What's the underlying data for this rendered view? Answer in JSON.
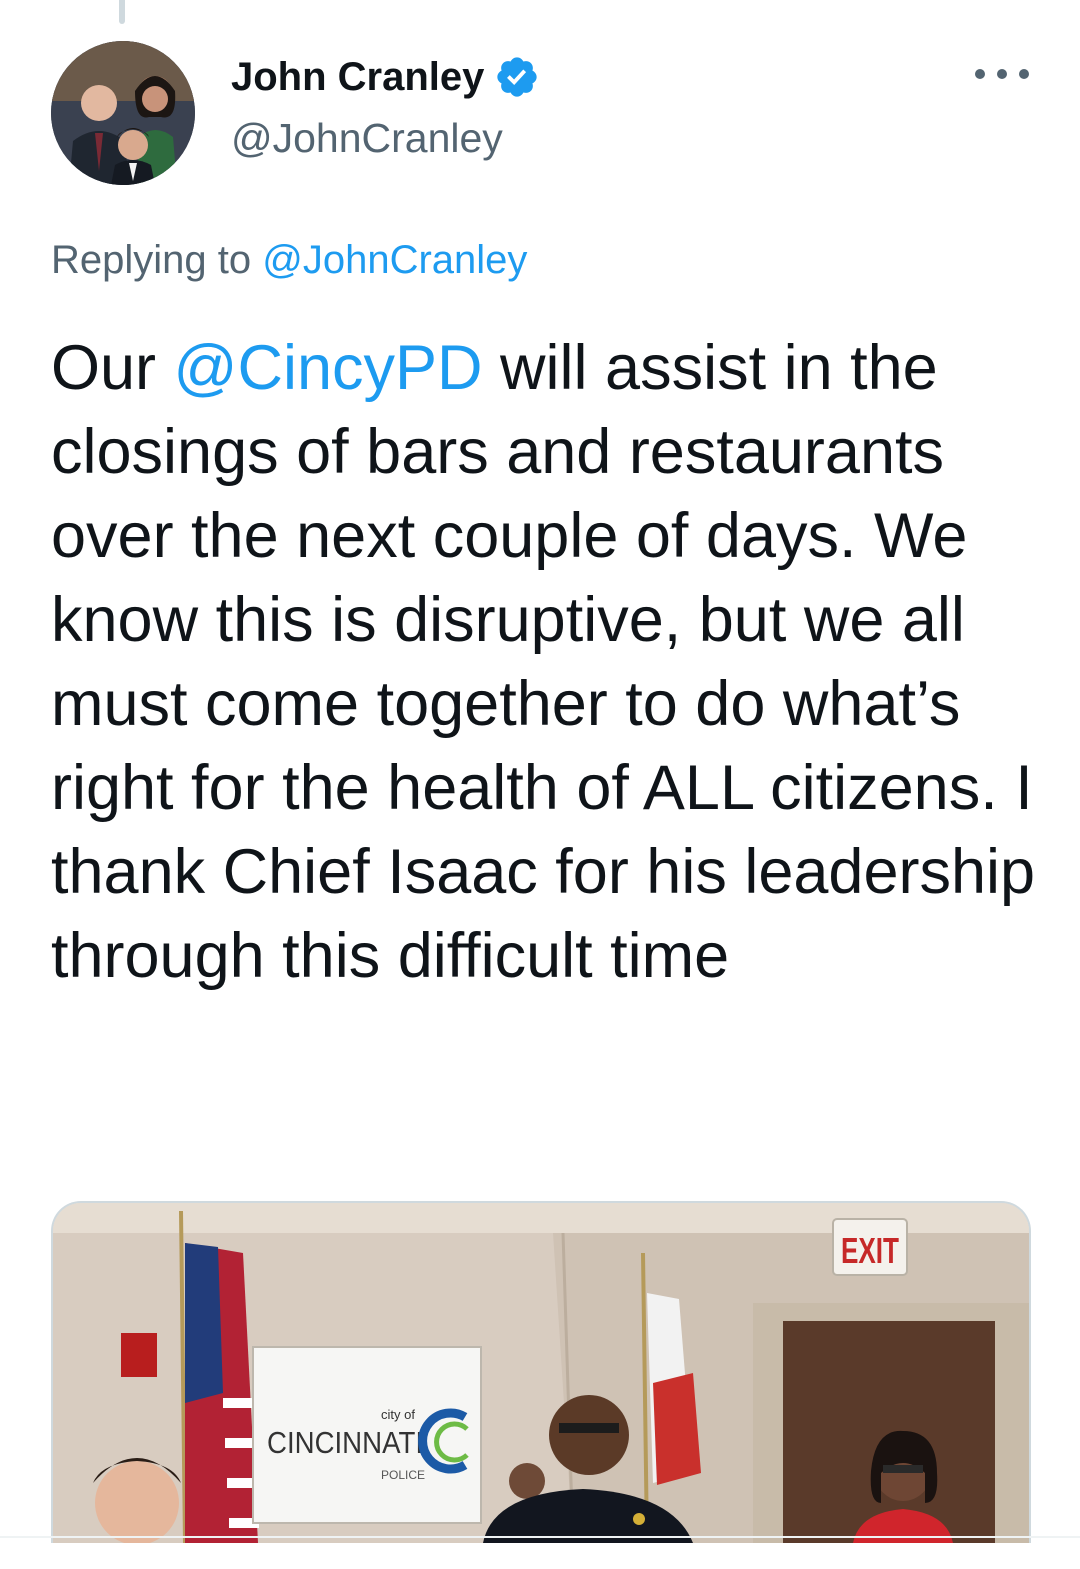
{
  "author": {
    "display_name": "John Cranley",
    "handle": "@JohnCranley",
    "verified": true,
    "avatar_icon": "avatar-photo"
  },
  "reply": {
    "prefix": "Replying to ",
    "mention": "@JohnCranley"
  },
  "tweet": {
    "before": "Our ",
    "mention": "@CincyPD",
    "after": " will assist in the closings of bars and restaurants over the next couple of days. We know this is disruptive, but we all must come together to do what’s right for the health of ALL citizens. I thank Chief Isaac for his leadership through this difficult time"
  },
  "media": {
    "sign_city_of": "city of",
    "sign_name": "CINCINNATI",
    "sign_sub": "POLICE",
    "exit_sign": "EXIT"
  },
  "colors": {
    "accent": "#1d9bf0",
    "text": "#0f1419",
    "secondary": "#536471"
  }
}
